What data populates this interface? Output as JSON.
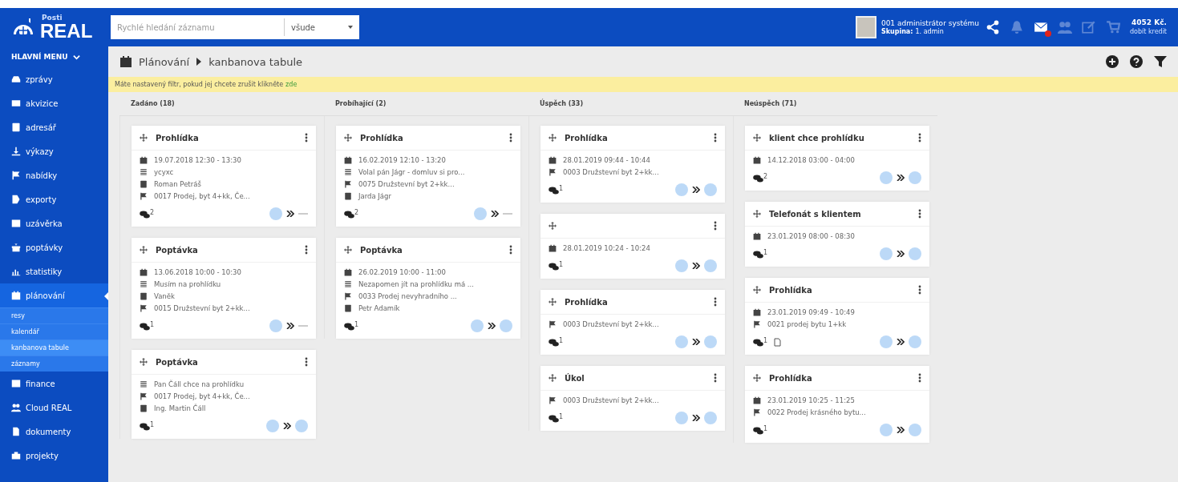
{
  "brand": {
    "small": "Posti",
    "big": "REAL"
  },
  "search": {
    "placeholder": "Rychlé hledání záznamu",
    "scope": "všude"
  },
  "user": {
    "name": "001 administrátor systému",
    "group_label": "Skupina:",
    "group": "1. admin"
  },
  "header_icons": [
    {
      "kind": "share",
      "disabled": false
    },
    {
      "kind": "bell",
      "disabled": true
    },
    {
      "kind": "mail",
      "disabled": false,
      "badge": true
    },
    {
      "kind": "people",
      "disabled": true
    },
    {
      "kind": "edit",
      "disabled": true
    },
    {
      "kind": "cart",
      "disabled": true
    }
  ],
  "credit": {
    "amount": "4052 Kč.",
    "link": "dobít kredit"
  },
  "sidebar": {
    "title": "HLAVNÍ MENU",
    "items": [
      {
        "label": "zprávy",
        "kind": "inbox",
        "selected": false
      },
      {
        "label": "akvizice",
        "kind": "card",
        "selected": false
      },
      {
        "label": "adresář",
        "kind": "person",
        "selected": false
      },
      {
        "label": "výkazy",
        "kind": "download",
        "selected": false
      },
      {
        "label": "nabídky",
        "kind": "flag",
        "selected": false
      },
      {
        "label": "exporty",
        "kind": "export",
        "selected": false
      },
      {
        "label": "uzávěrka",
        "kind": "box",
        "selected": false
      },
      {
        "label": "poptávky",
        "kind": "gift",
        "selected": false
      },
      {
        "label": "statistiky",
        "kind": "chart",
        "selected": false
      },
      {
        "label": "plánování",
        "kind": "calendar",
        "selected": true,
        "children": [
          {
            "label": "resy",
            "selected": false
          },
          {
            "label": "kalendář",
            "selected": false
          },
          {
            "label": "kanbanova tabule",
            "selected": true
          },
          {
            "label": "záznamy",
            "selected": false
          }
        ]
      },
      {
        "label": "finance",
        "kind": "box",
        "selected": false
      },
      {
        "label": "Cloud REAL",
        "kind": "people",
        "selected": false
      },
      {
        "label": "dokumenty",
        "kind": "doc",
        "selected": false
      },
      {
        "label": "projekty",
        "kind": "briefcase",
        "selected": false
      }
    ]
  },
  "breadcrumb": {
    "section": "Plánování",
    "page": "kanbanova tabule"
  },
  "filter_notice": {
    "text": "Máte nastavený filtr, pokud jej chcete zrušit klikněte",
    "link": "zde"
  },
  "columns": [
    {
      "title": "Zadáno (18)",
      "cards": [
        {
          "title": "Prohlídka",
          "lines": [
            {
              "kind": "date",
              "text": "19.07.2018 12:30 - 13:30"
            },
            {
              "kind": "note",
              "text": "ycyxc"
            },
            {
              "kind": "person",
              "text": "Roman Petráš"
            },
            {
              "kind": "flag",
              "text": "0017 Prodej, byt 4+kk, Če..."
            }
          ],
          "comments": "2",
          "attachment": false,
          "assigned": false
        },
        {
          "title": "Poptávka",
          "lines": [
            {
              "kind": "date",
              "text": "13.06.2018 10:00 - 10:30"
            },
            {
              "kind": "note",
              "text": "Musím na prohlídku"
            },
            {
              "kind": "person",
              "text": "Vaněk"
            },
            {
              "kind": "flag",
              "text": "0015 Družstevní byt 2+kk..."
            }
          ],
          "comments": "1",
          "attachment": false,
          "assigned": false
        },
        {
          "title": "Poptávka",
          "lines": [
            {
              "kind": "note",
              "text": "Pan Čáll chce na prohlídku"
            },
            {
              "kind": "flag",
              "text": "0017 Prodej, byt 4+kk, Če..."
            },
            {
              "kind": "person",
              "text": "Ing. Martin Čáll"
            }
          ],
          "comments": "1",
          "attachment": false,
          "assigned": true
        }
      ]
    },
    {
      "title": "Probíhající (2)",
      "cards": [
        {
          "title": "Prohlídka",
          "lines": [
            {
              "kind": "date",
              "text": "16.02.2019 12:10 - 13:20"
            },
            {
              "kind": "note",
              "text": "Volal pán Jágr - domluv si pro..."
            },
            {
              "kind": "flag",
              "text": "0075 Družstevní byt 2+kk..."
            },
            {
              "kind": "person",
              "text": "Jarda Jágr"
            }
          ],
          "comments": "2",
          "attachment": false,
          "assigned": false
        },
        {
          "title": "Poptávka",
          "lines": [
            {
              "kind": "date",
              "text": "26.02.2019 10:00 - 11:00"
            },
            {
              "kind": "note",
              "text": "Nezapomen jít na prohlídku má ..."
            },
            {
              "kind": "flag",
              "text": "0033 Prodej nevyhradního ..."
            },
            {
              "kind": "person",
              "text": "Petr Adamík"
            }
          ],
          "comments": "1",
          "attachment": false,
          "assigned": true
        }
      ]
    },
    {
      "title": "Úspěch (33)",
      "cards": [
        {
          "title": "Prohlídka",
          "lines": [
            {
              "kind": "date",
              "text": "28.01.2019 09:44 - 10:44"
            },
            {
              "kind": "flag",
              "text": "0003 Družstevní byt 2+kk..."
            }
          ],
          "comments": "1",
          "attachment": false,
          "assigned": true
        },
        {
          "lines": [
            {
              "kind": "date",
              "text": "28.01.2019 10:24 - 10:24"
            }
          ],
          "comments": "1",
          "attachment": false,
          "assigned": true
        },
        {
          "title": "Prohlídka",
          "lines": [
            {
              "kind": "flag",
              "text": "0003 Družstevní byt 2+kk..."
            }
          ],
          "comments": "1",
          "attachment": false,
          "assigned": true
        },
        {
          "title": "Úkol",
          "lines": [
            {
              "kind": "flag",
              "text": "0003 Družstevní byt 2+kk..."
            }
          ],
          "comments": "1",
          "attachment": false,
          "assigned": true
        }
      ]
    },
    {
      "title": "Neúspěch (71)",
      "cards": [
        {
          "title": "klient chce prohlídku",
          "lines": [
            {
              "kind": "date",
              "text": "14.12.2018 03:00 - 04:00"
            }
          ],
          "comments": "2",
          "attachment": false,
          "assigned": true
        },
        {
          "title": "Telefonát s klientem",
          "lines": [
            {
              "kind": "date",
              "text": "23.01.2019 08:00 - 08:30"
            }
          ],
          "comments": "1",
          "attachment": false,
          "assigned": true
        },
        {
          "title": "Prohlídka",
          "lines": [
            {
              "kind": "date",
              "text": "23.01.2019 09:49 - 10:49"
            },
            {
              "kind": "flag",
              "text": "0021 prodej bytu 1+kk"
            }
          ],
          "comments": "1",
          "attachment": true,
          "assigned": true
        },
        {
          "title": "Prohlídka",
          "lines": [
            {
              "kind": "date",
              "text": "23.01.2019 10:25 - 11:25"
            },
            {
              "kind": "flag",
              "text": "0022 Prodej krásného bytu..."
            }
          ],
          "comments": "1",
          "attachment": false,
          "assigned": true
        }
      ]
    }
  ]
}
